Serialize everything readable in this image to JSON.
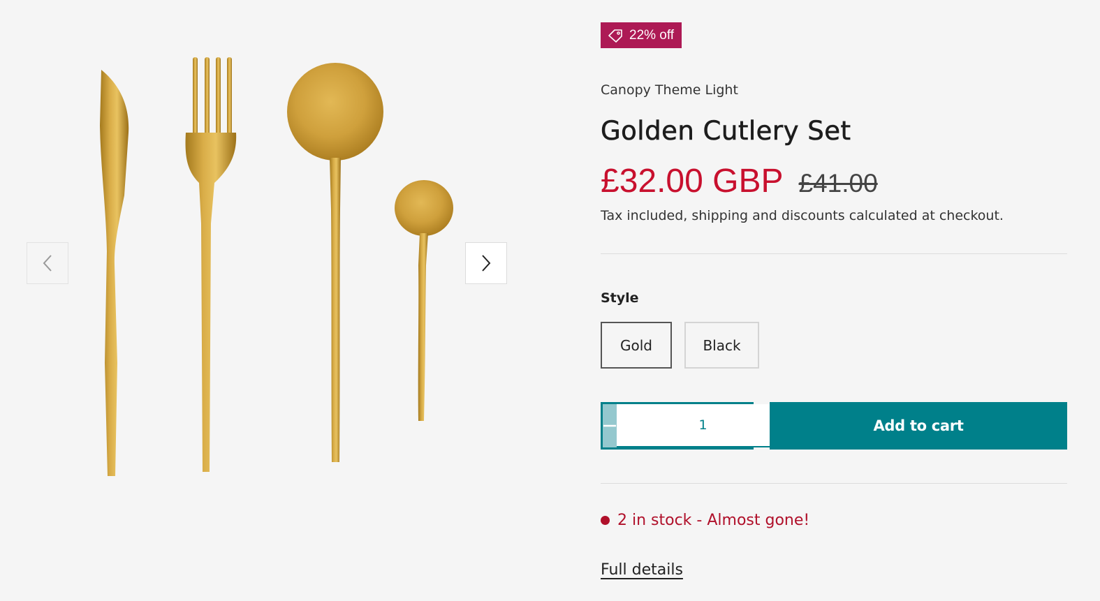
{
  "gallery": {
    "image_alt": "Golden Cutlery Set product image",
    "prev_icon": "chevron-left-icon",
    "next_icon": "chevron-right-icon"
  },
  "product": {
    "badge": {
      "icon": "tag-icon",
      "text": "22% off",
      "color": "#ad1a55"
    },
    "vendor": "Canopy Theme Light",
    "title": "Golden Cutlery Set",
    "price": "£32.00 GBP",
    "compare_price": "£41.00",
    "tax_note": "Tax included, shipping and discounts calculated at checkout.",
    "style": {
      "label": "Style",
      "options": [
        "Gold",
        "Black"
      ],
      "selected": "Gold"
    },
    "quantity": {
      "value": "1",
      "minus_icon": "minus-icon",
      "plus_icon": "plus-icon"
    },
    "add_to_cart": "Add to cart",
    "stock": "2 in stock - Almost gone!",
    "full_details": "Full details"
  },
  "colors": {
    "accent": "#00808a",
    "sale_price": "#c8102e",
    "stock_warning": "#b0102a"
  }
}
